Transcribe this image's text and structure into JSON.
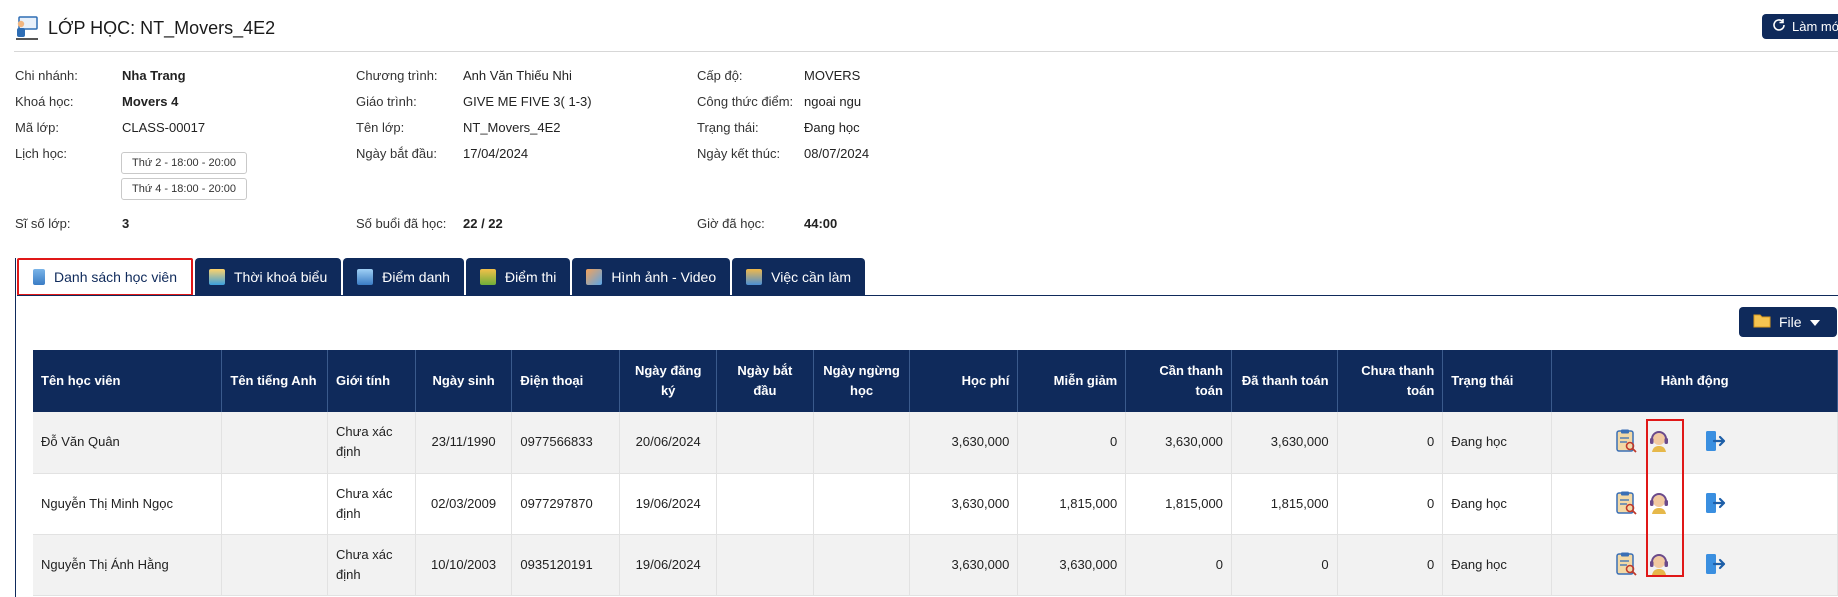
{
  "header": {
    "title": "LỚP HỌC: NT_Movers_4E2",
    "refresh_label": "Làm mới"
  },
  "info": {
    "branch_label": "Chi nhánh:",
    "branch": "Nha Trang",
    "program_label": "Chương trình:",
    "program": "Anh Văn Thiếu Nhi",
    "level_label": "Cấp độ:",
    "level": "MOVERS",
    "course_label": "Khoá học:",
    "course": "Movers 4",
    "curriculum_label": "Giáo trình:",
    "curriculum": "GIVE ME FIVE 3( 1-3)",
    "formula_label": "Công thức điểm:",
    "formula": "ngoai ngu",
    "class_code_label": "Mã lớp:",
    "class_code": "CLASS-00017",
    "class_name_label": "Tên lớp:",
    "class_name": "NT_Movers_4E2",
    "status_label": "Trạng thái:",
    "status": "Đang học",
    "schedule_label": "Lịch học:",
    "schedule": [
      "Thứ 2 - 18:00 - 20:00",
      "Thứ 4 - 18:00 - 20:00"
    ],
    "start_label": "Ngày bắt đầu:",
    "start": "17/04/2024",
    "end_label": "Ngày kết thúc:",
    "end": "08/07/2024",
    "size_label": "Sĩ số lớp:",
    "size": "3",
    "sessions_label": "Số buổi đã học:",
    "sessions": "22 / 22",
    "hours_label": "Giờ đã học:",
    "hours": "44:00"
  },
  "tabs": [
    {
      "label": "Danh sách học viên",
      "icon": "student-list-icon"
    },
    {
      "label": "Thời khoá biểu",
      "icon": "timetable-icon"
    },
    {
      "label": "Điểm danh",
      "icon": "attendance-icon"
    },
    {
      "label": "Điểm thi",
      "icon": "exam-score-icon"
    },
    {
      "label": "Hình ảnh - Video",
      "icon": "media-icon"
    },
    {
      "label": "Việc cần làm",
      "icon": "todo-icon"
    }
  ],
  "file_button": {
    "label": "File"
  },
  "table": {
    "headers": [
      "Tên học viên",
      "Tên tiếng Anh",
      "Giới tính",
      "Ngày sinh",
      "Điện thoại",
      "Ngày đăng ký",
      "Ngày bắt đầu",
      "Ngày ngừng học",
      "Học phí",
      "Miễn giảm",
      "Cần thanh toán",
      "Đã thanh toán",
      "Chưa thanh toán",
      "Trạng thái",
      "Hành động"
    ],
    "rows": [
      [
        "Đỗ Văn Quân",
        "",
        "Chưa xác định",
        "23/11/1990",
        "0977566833",
        "20/06/2024",
        "",
        "",
        "3,630,000",
        "0",
        "3,630,000",
        "3,630,000",
        "0",
        "Đang học"
      ],
      [
        "Nguyễn Thị Minh Ngọc",
        "",
        "Chưa xác định",
        "02/03/2009",
        "0977297870",
        "19/06/2024",
        "",
        "",
        "3,630,000",
        "1,815,000",
        "1,815,000",
        "1,815,000",
        "0",
        "Đang học"
      ],
      [
        "Nguyễn Thị Ánh Hằng",
        "",
        "Chưa xác định",
        "10/10/2003",
        "0935120191",
        "19/06/2024",
        "",
        "",
        "3,630,000",
        "3,630,000",
        "0",
        "0",
        "0",
        "Đang học"
      ]
    ],
    "actions": [
      "view-detail-icon",
      "consult-icon",
      "exit-class-icon"
    ]
  },
  "colors": {
    "navy": "#0f2a5b",
    "highlight": "#e01818"
  }
}
